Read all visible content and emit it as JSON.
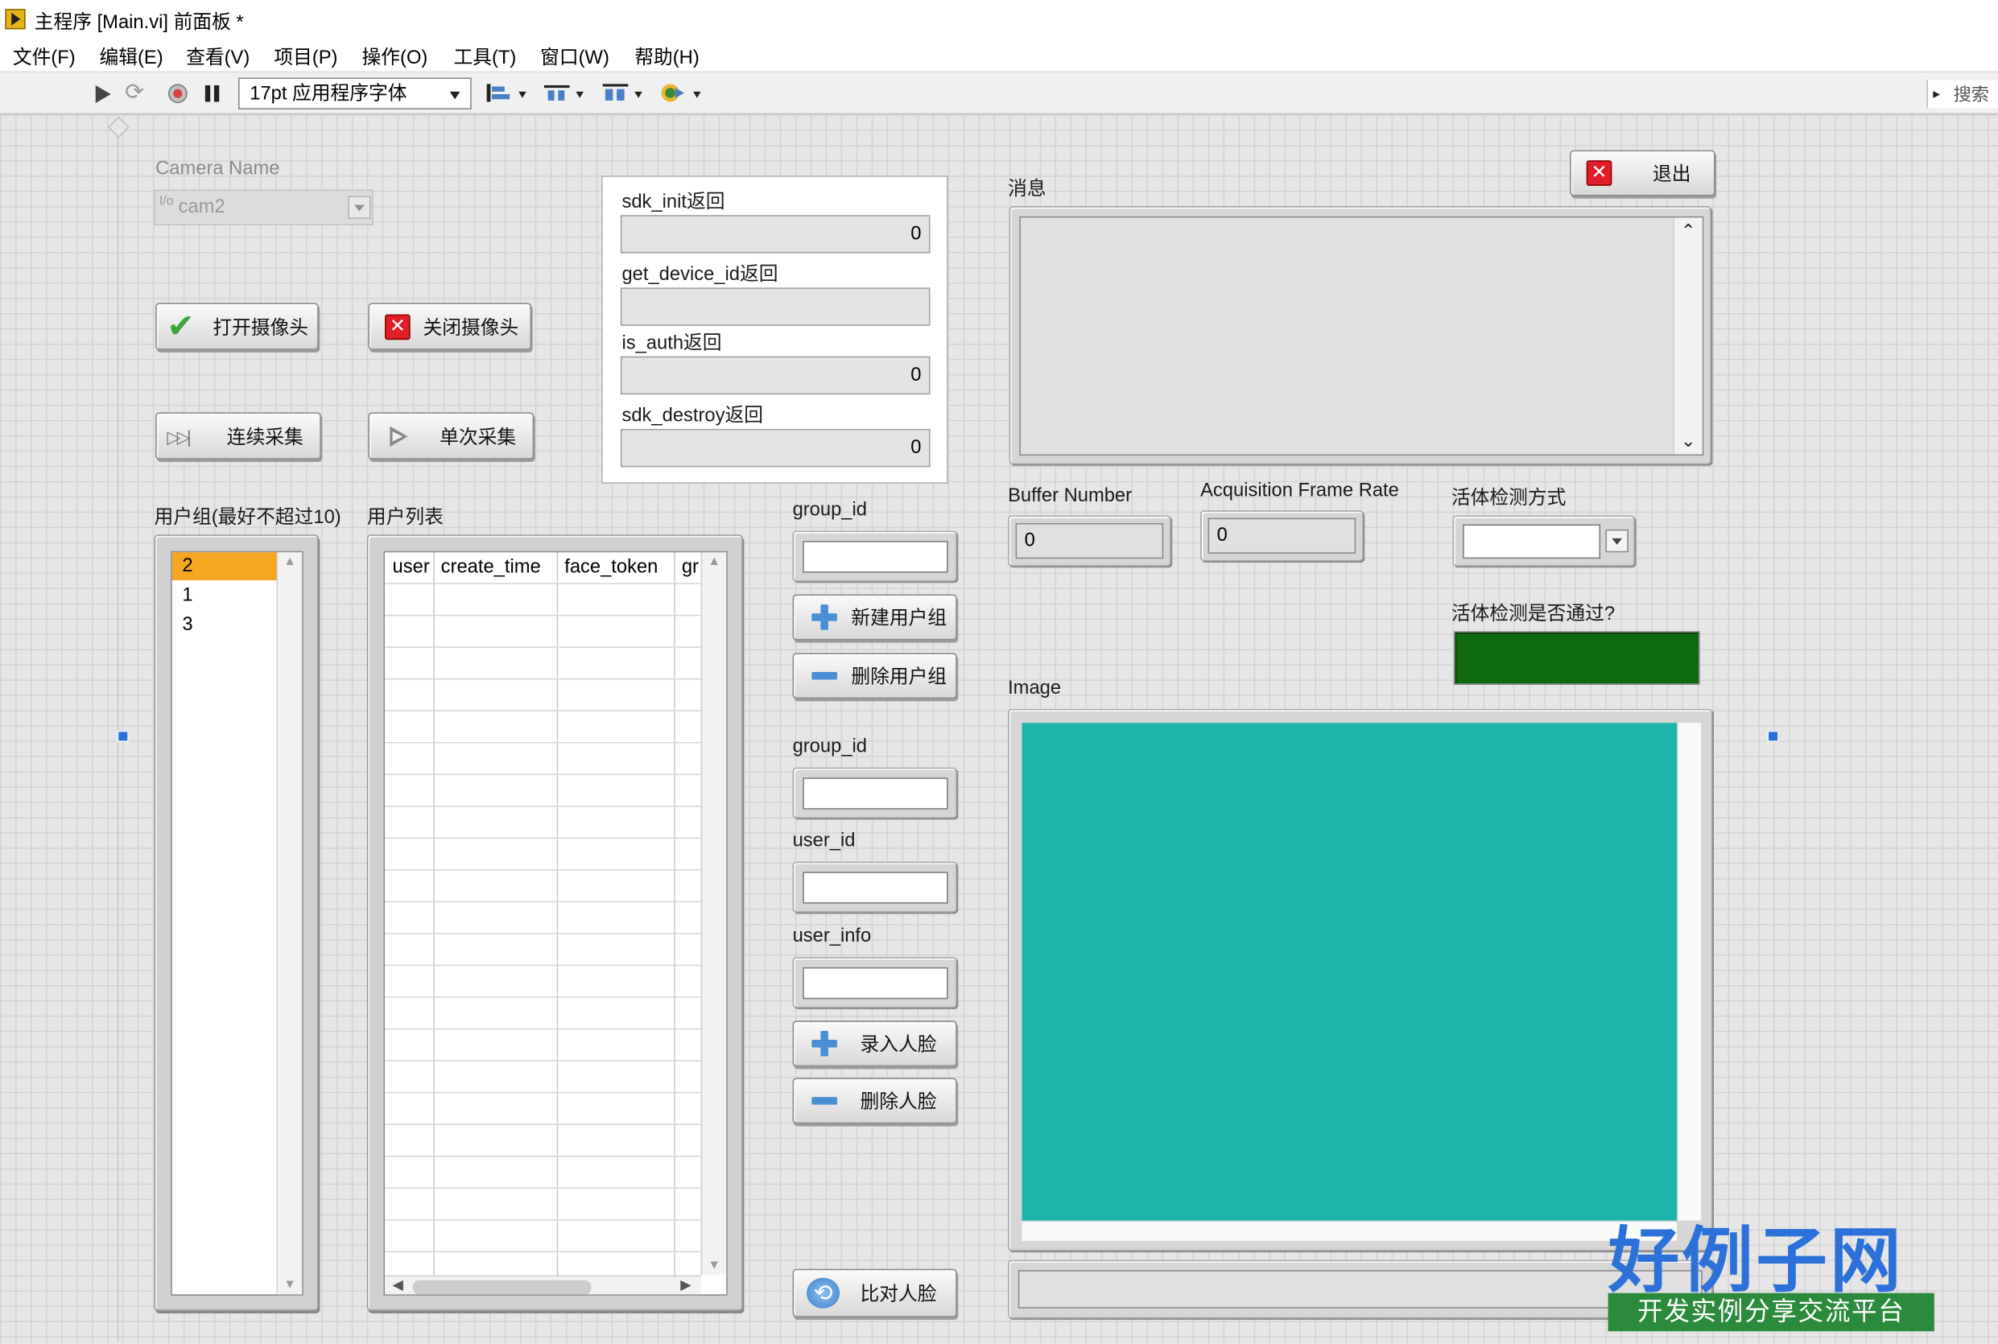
{
  "window": {
    "title": "主程序 [Main.vi] 前面板 *"
  },
  "menu": [
    "文件(F)",
    "编辑(E)",
    "查看(V)",
    "项目(P)",
    "操作(O)",
    "工具(T)",
    "窗口(W)",
    "帮助(H)"
  ],
  "toolbar": {
    "font_select": "17pt 应用程序字体",
    "search_label": "搜索",
    "icons": [
      "run-arrow-icon",
      "run-continuously-icon",
      "abort-icon",
      "pause-icon",
      "align-icon",
      "distribute-icon",
      "resize-icon",
      "reorder-icon"
    ]
  },
  "camera": {
    "label": "Camera Name",
    "value": "cam2",
    "prefix": "I/o"
  },
  "buttons": {
    "open_camera": "打开摄像头",
    "close_camera": "关闭摄像头",
    "continuous_capture": "连续采集",
    "single_capture": "单次采集",
    "exit": "退出",
    "new_group": "新建用户组",
    "delete_group": "删除用户组",
    "enroll_face": "录入人脸",
    "delete_face": "删除人脸",
    "compare_face": "比对人脸"
  },
  "sdk_cluster": {
    "sdk_init_label": "sdk_init返回",
    "sdk_init_value": "0",
    "get_device_id_label": "get_device_id返回",
    "get_device_id_value": "",
    "is_auth_label": "is_auth返回",
    "is_auth_value": "0",
    "sdk_destroy_label": "sdk_destroy返回",
    "sdk_destroy_value": "0"
  },
  "group_list": {
    "label": "用户组(最好不超过10)",
    "items": [
      "2",
      "1",
      "3"
    ],
    "selected_index": 0
  },
  "user_list": {
    "label": "用户列表",
    "columns": [
      "user",
      "create_time",
      "face_token",
      "gr"
    ]
  },
  "fields": {
    "group_id_label_1": "group_id",
    "group_id_value_1": "",
    "group_id_label_2": "group_id",
    "group_id_value_2": "",
    "user_id_label": "user_id",
    "user_id_value": "",
    "user_info_label": "user_info",
    "user_info_value": ""
  },
  "message": {
    "label": "消息",
    "value": ""
  },
  "buffer_number": {
    "label": "Buffer Number",
    "value": "0"
  },
  "acq_frame_rate": {
    "label": "Acquisition Frame Rate",
    "value": "0"
  },
  "liveness_mode": {
    "label": "活体检测方式",
    "value": ""
  },
  "liveness_pass": {
    "label": "活体检测是否通过?",
    "state": true,
    "color": "#0e6a0e"
  },
  "image": {
    "label": "Image",
    "fill_color": "#1eb4ac"
  },
  "watermark": {
    "title": "好例子网",
    "subtitle": "开发实例分享交流平台"
  }
}
